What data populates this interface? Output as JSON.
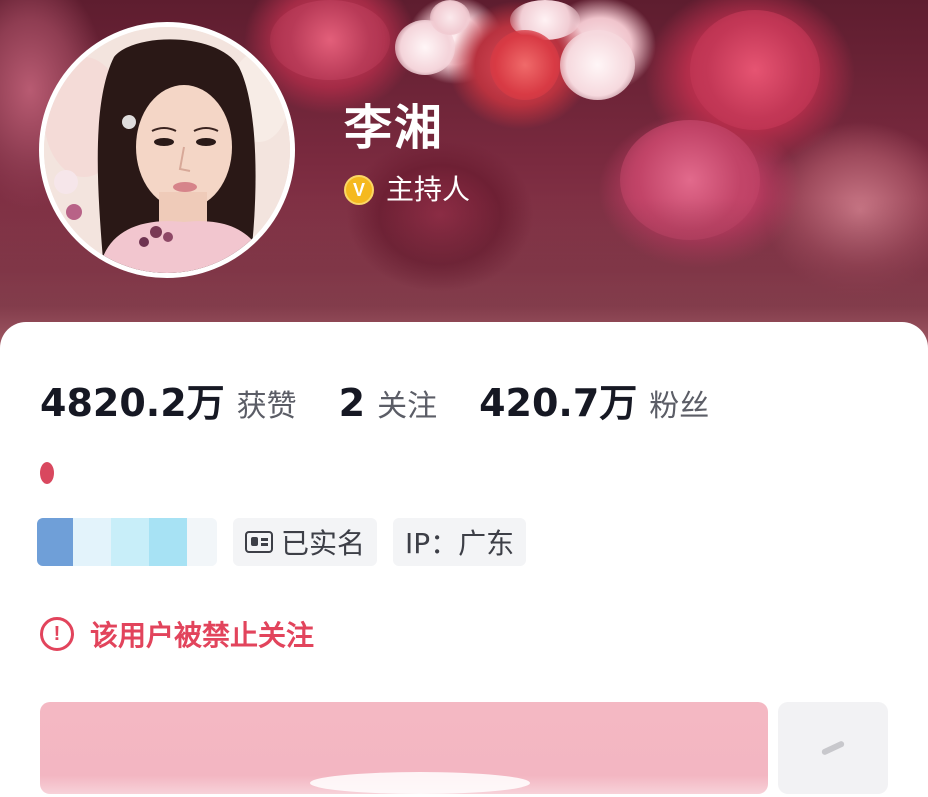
{
  "profile": {
    "name": "李湘",
    "verified_badge": "V",
    "verified_title": "主持人"
  },
  "stats": [
    {
      "value": "4820.2万",
      "label": "获赞"
    },
    {
      "value": "2",
      "label": "关注"
    },
    {
      "value": "420.7万",
      "label": "粉丝"
    }
  ],
  "tags": {
    "real_name": "已实名",
    "ip": "IP：广东"
  },
  "notice": {
    "icon": "!",
    "text": "该用户被禁止关注"
  },
  "colors": {
    "accent_red": "#e2445c",
    "verified_gold": "#f5b91f",
    "follow_button_pink": "#f4b8c3"
  },
  "icons": {
    "verified": "v-badge-icon",
    "real_name": "id-card-icon",
    "notice": "exclamation-circle-icon",
    "more": "more-icon"
  }
}
